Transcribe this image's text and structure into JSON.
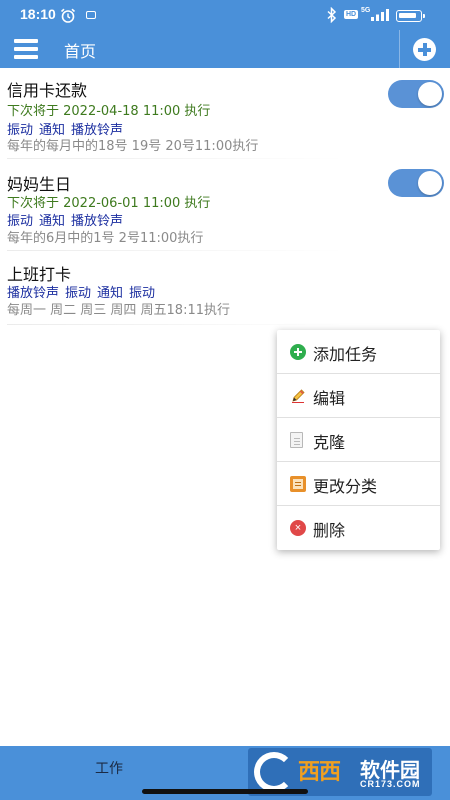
{
  "status_bar": {
    "time": "18:10",
    "hd_badge": "HD",
    "network": "5G",
    "icons": [
      "alarm-icon",
      "mail-icon",
      "bluetooth-icon",
      "signal-icon",
      "battery-icon"
    ]
  },
  "app_bar": {
    "title": "首页",
    "menu_icon": "hamburger-menu-icon",
    "add_icon": "add-circle-icon"
  },
  "tasks": [
    {
      "title": "信用卡还款",
      "next_run": "下次将于 2022-04-18 11:00 执行",
      "actions": [
        "振动",
        "通知",
        "播放铃声"
      ],
      "schedule": "每年的每月中的18号 19号 20号11:00执行",
      "enabled": true
    },
    {
      "title": "妈妈生日",
      "next_run": "下次将于 2022-06-01 11:00 执行",
      "actions": [
        "振动",
        "通知",
        "播放铃声"
      ],
      "schedule": "每年的6月中的1号 2号11:00执行",
      "enabled": true
    },
    {
      "title": "上班打卡",
      "actions": [
        "播放铃声",
        "振动",
        "通知",
        "振动"
      ],
      "schedule": "每周一 周二 周三 周四 周五18:11执行"
    }
  ],
  "popup_menu": {
    "items": [
      {
        "label": "添加任务",
        "icon": "add-task-icon"
      },
      {
        "label": "编辑",
        "icon": "edit-pencil-icon"
      },
      {
        "label": "克隆",
        "icon": "clone-document-icon"
      },
      {
        "label": "更改分类",
        "icon": "category-icon"
      },
      {
        "label": "删除",
        "icon": "delete-icon"
      }
    ]
  },
  "bottom_bar": {
    "tab_label": "工作",
    "watermark": {
      "brand_cn_1": "西西",
      "brand_cn_2": "软件园",
      "url": "CR173.COM"
    }
  },
  "colors": {
    "primary": "#4a90d9",
    "next_run_text": "#3e7a1e",
    "action_text": "#1c2fa0",
    "schedule_text": "#8a8a8a",
    "toggle_on": "#5a92d6"
  }
}
